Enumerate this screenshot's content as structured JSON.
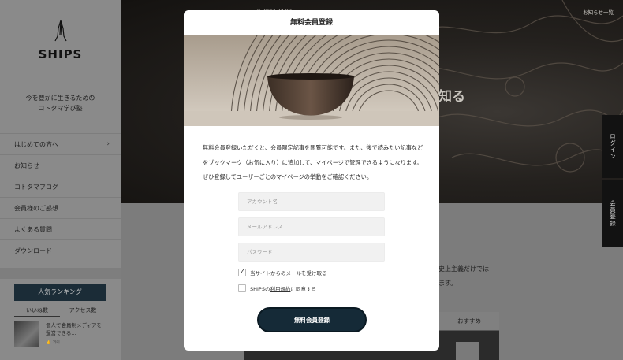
{
  "brand": {
    "name": "SHIPS",
    "tagline_line1": "今を豊かに生きるための",
    "tagline_line2": "コトタマ学び塾"
  },
  "sidebar": {
    "nav": [
      {
        "label": "はじめての方へ",
        "has_chevron": true,
        "chevron": "›"
      },
      {
        "label": "お知らせ"
      },
      {
        "label": "コトタマブログ"
      },
      {
        "label": "会員様のご感想"
      },
      {
        "label": "よくある質問"
      },
      {
        "label": "ダウンロード"
      }
    ],
    "ranking": {
      "title": "人気ランキング",
      "tabs": [
        "いいね数",
        "アクセス数"
      ],
      "item_title": "個人で会員制メディアを運営できる...",
      "item_meta": "👍 2回"
    }
  },
  "hero": {
    "date": "◎ 2023.02.09",
    "news_link": "お知らせ一覧",
    "title_fragment": "知る"
  },
  "content": {
    "line1": "史上主義だけでは",
    "line2": "ます。",
    "tab": "おすすめ"
  },
  "side_tabs": {
    "login": "ログイン",
    "signup": "会員登録"
  },
  "modal": {
    "title": "無料会員登録",
    "description": "無料会員登録いただくと、会員限定記事を閲覧可能です。また、後で読みたい記事などをブックマーク（お気に入り）に追加して、マイページで管理できるようになります。ぜひ登録してユーザーごとのマイページの挙動をご確認ください。",
    "fields": {
      "account_placeholder": "アカウント名",
      "email_placeholder": "メールアドレス",
      "password_placeholder": "パスワード"
    },
    "checkboxes": {
      "newsletter_label": "当サイトからのメールを受け取る",
      "newsletter_checked": true,
      "tick": "✓",
      "terms_prefix": "SHIPSの",
      "terms_link": "利用規約",
      "terms_suffix": "に同意する",
      "terms_checked": false
    },
    "submit_label": "無料会員登録"
  },
  "colors": {
    "accent_navy": "#152a37",
    "overlay": "#555555",
    "modal_bg": "#ffffff"
  }
}
